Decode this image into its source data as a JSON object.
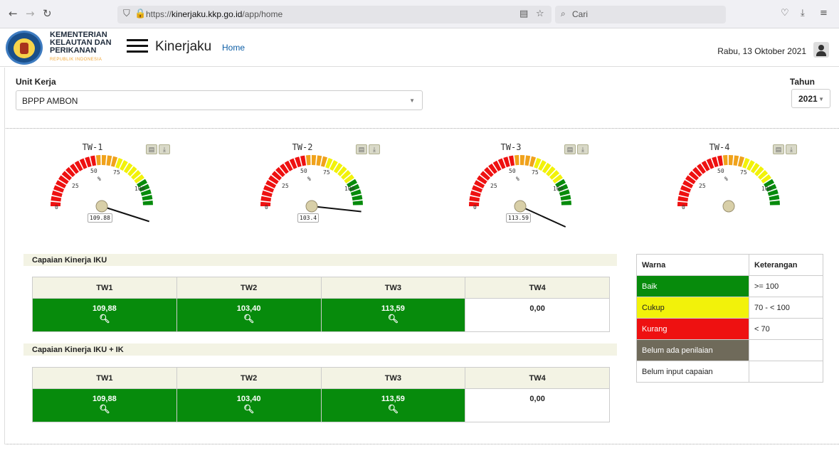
{
  "browser": {
    "url_prefix": "https://",
    "url_domain": "kinerjaku.kkp.go.id",
    "url_path": "/app/home",
    "search_placeholder": "Cari"
  },
  "header": {
    "ministry_line1": "KEMENTERIAN",
    "ministry_line2": "KELAUTAN DAN",
    "ministry_line3": "PERIKANAN",
    "ministry_sub": "REPUBLIK INDONESIA",
    "app_name": "Kinerjaku",
    "home_link": "Home",
    "date": "Rabu, 13 Oktober 2021"
  },
  "filters": {
    "unit_label": "Unit Kerja",
    "unit_value": "BPPP AMBON",
    "year_label": "Tahun",
    "year_value": "2021"
  },
  "gauges": [
    {
      "title": "TW-1",
      "value": 109.88,
      "value_text": "109.88"
    },
    {
      "title": "TW-2",
      "value": 103.4,
      "value_text": "103.4"
    },
    {
      "title": "TW-3",
      "value": 113.59,
      "value_text": "113.59"
    },
    {
      "title": "TW-4",
      "value": null,
      "value_text": ""
    }
  ],
  "gauge_ticks": [
    "0",
    "25",
    "50",
    "75",
    "100"
  ],
  "gauge_unit": "%",
  "table_iku": {
    "title": "Capaian Kinerja IKU",
    "headers": [
      "TW1",
      "TW2",
      "TW3",
      "TW4"
    ],
    "values": [
      "109,88",
      "103,40",
      "113,59",
      "0,00"
    ]
  },
  "table_iku_ik": {
    "title": "Capaian Kinerja IKU + IK",
    "headers": [
      "TW1",
      "TW2",
      "TW3",
      "TW4"
    ],
    "values": [
      "109,88",
      "103,40",
      "113,59",
      "0,00"
    ]
  },
  "legend": {
    "col_warna": "Warna",
    "col_keterangan": "Keterangan",
    "rows": [
      {
        "label": "Baik",
        "desc": ">= 100",
        "color": "#078b0c",
        "text_color": "#ffffff"
      },
      {
        "label": "Cukup",
        "desc": "70 - < 100",
        "color": "#f2f20a",
        "text_color": "#222222"
      },
      {
        "label": "Kurang",
        "desc": "< 70",
        "color": "#ee1111",
        "text_color": "#ffffff"
      },
      {
        "label": "Belum ada penilaian",
        "desc": "",
        "color": "#6f6a5a",
        "text_color": "#ffffff"
      },
      {
        "label": "Belum input capaian",
        "desc": "",
        "color": "#ffffff",
        "text_color": "#222222"
      }
    ]
  },
  "colors": {
    "good": "#078b0c",
    "warning": "#f2f20a",
    "orange": "#f0a21b",
    "bad": "#ee1111",
    "accent": "#0d5ea6"
  },
  "icons": {
    "print": "print-icon",
    "download": "download-icon",
    "detail": "magnifier-icon"
  }
}
